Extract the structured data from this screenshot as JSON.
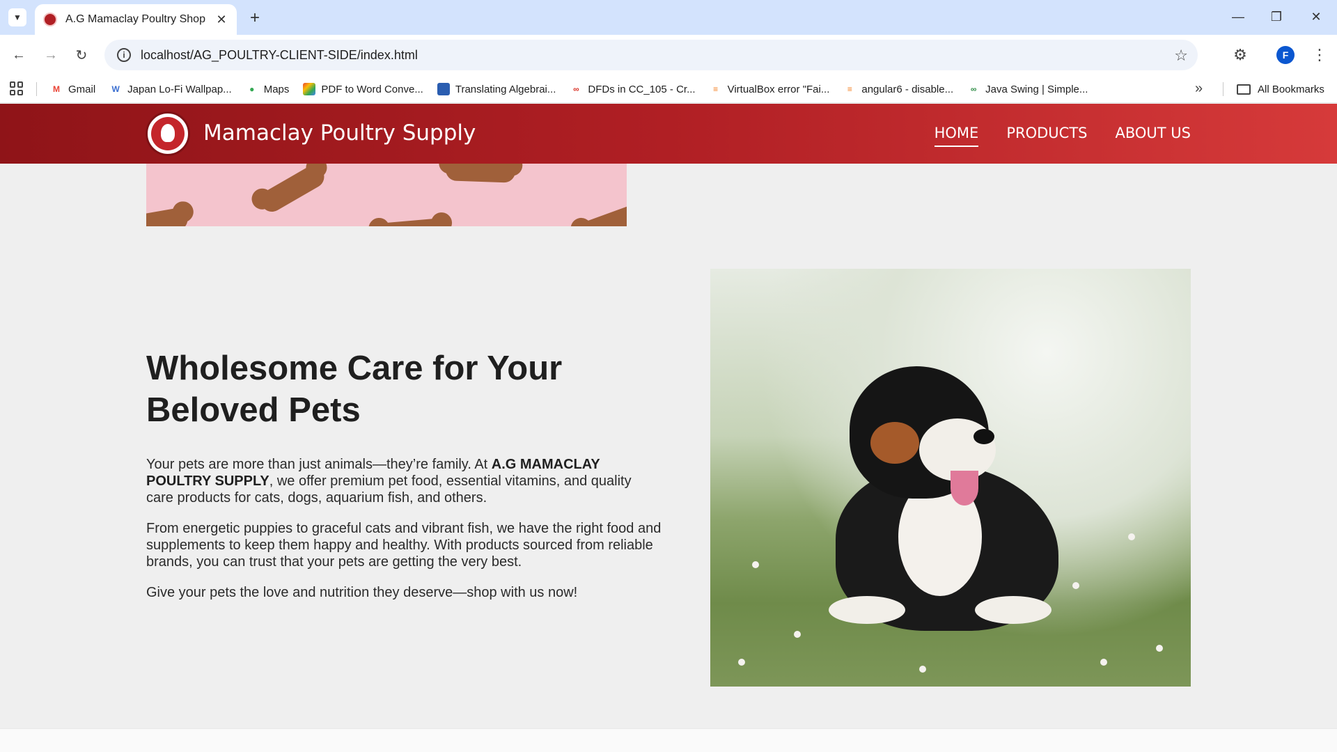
{
  "browser": {
    "tab_title": "A.G Mamaclay Poultry Shop",
    "url": "localhost/AG_POULTRY-CLIENT-SIDE/index.html",
    "profile_initial": "F",
    "bookmarks": [
      {
        "label": "Gmail",
        "icon": "gmail-icon",
        "color": "#ea4335"
      },
      {
        "label": "Japan Lo-Fi Wallpap...",
        "icon": "w-icon",
        "color": "#3b6fd1"
      },
      {
        "label": "Maps",
        "icon": "maps-icon",
        "color": "#34a853"
      },
      {
        "label": "PDF to Word Conve...",
        "icon": "pdf-icon",
        "color": "#f4b400"
      },
      {
        "label": "Translating Algebrai...",
        "icon": "cube-icon",
        "color": "#2a5db0"
      },
      {
        "label": "DFDs in CC_105 - Cr...",
        "icon": "link-icon",
        "color": "#d93025"
      },
      {
        "label": "VirtualBox error \"Fai...",
        "icon": "stack-icon",
        "color": "#f48024"
      },
      {
        "label": "angular6 - disable...",
        "icon": "stack-icon",
        "color": "#f48024"
      },
      {
        "label": "Java Swing | Simple...",
        "icon": "gfg-icon",
        "color": "#2f8d46"
      }
    ],
    "all_bookmarks": "All Bookmarks"
  },
  "site": {
    "brand": "Mamaclay Poultry Supply",
    "nav": [
      "HOME",
      "PRODUCTS",
      "ABOUT US"
    ],
    "active_nav": "HOME",
    "accent": "#b01f24"
  },
  "hero": {
    "title": "Wholesome Care for Your Beloved Pets",
    "p1_before": "Your pets are more than just animals—they’re family. At ",
    "p1_bold": "A.G MAMACLAY POULTRY SUPPLY",
    "p1_after": ", we offer premium pet food, essential vitamins, and quality care products for cats, dogs, aquarium fish, and others.",
    "p2": "From energetic puppies to graceful cats and vibrant fish, we have the right food and supplements to keep them happy and healthy. With products sourced from reliable brands, you can trust that your pets are getting the very best.",
    "p3": "Give your pets the love and nutrition they deserve—shop with us now!"
  }
}
